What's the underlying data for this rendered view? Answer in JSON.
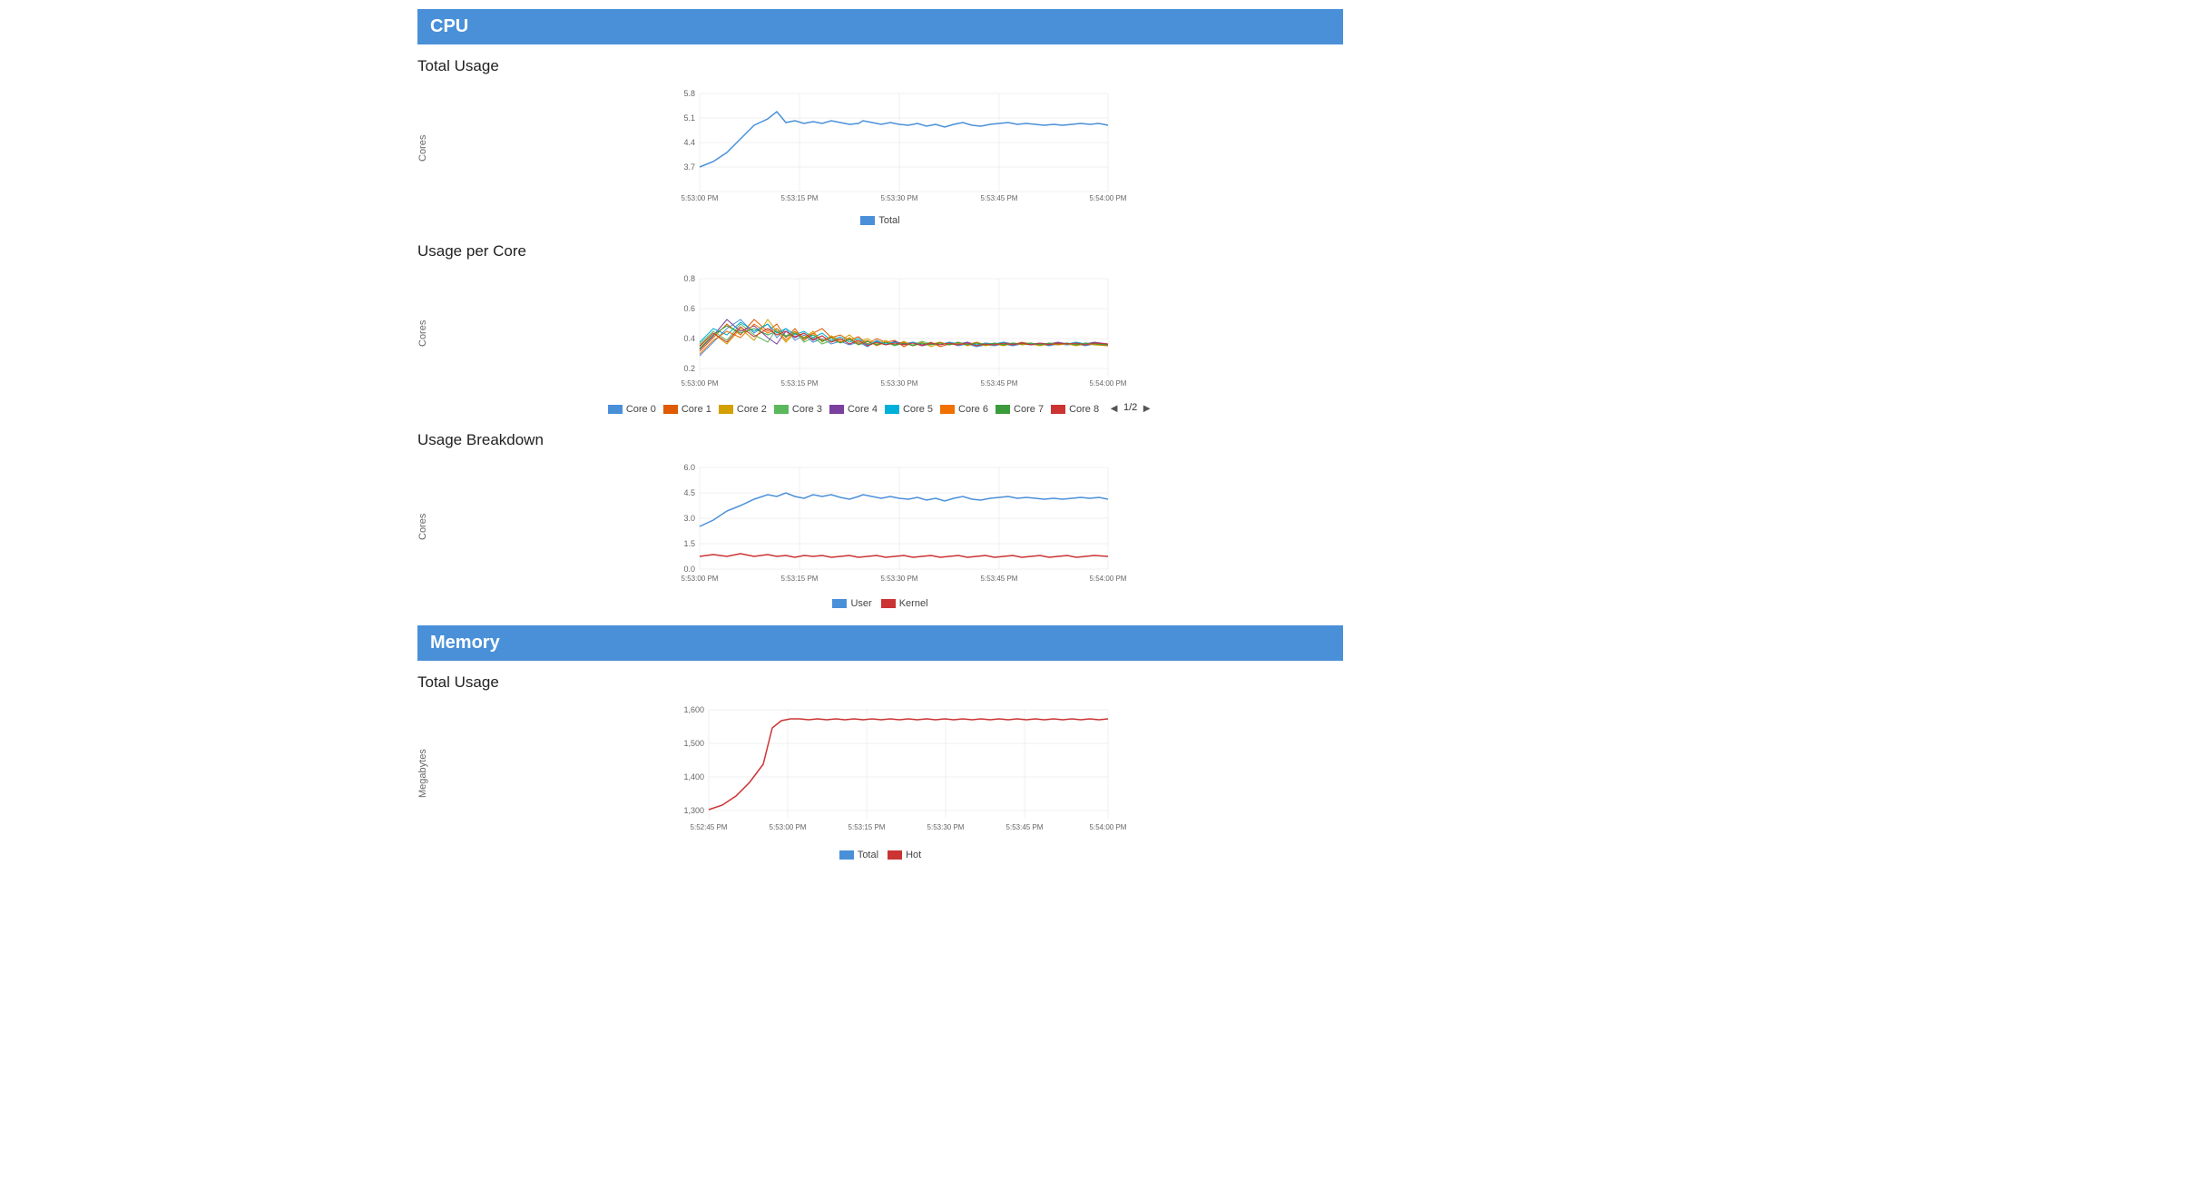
{
  "cpu_section": {
    "title": "CPU",
    "total_usage_title": "Total Usage",
    "per_core_title": "Usage per Core",
    "breakdown_title": "Usage Breakdown"
  },
  "memory_section": {
    "title": "Memory",
    "total_usage_title": "Total Usage"
  },
  "total_usage_chart": {
    "y_label": "Cores",
    "y_ticks": [
      "5.8",
      "5.1",
      "4.4",
      "3.7"
    ],
    "x_ticks": [
      "5:53:00 PM",
      "5:53:15 PM",
      "5:53:30 PM",
      "5:53:45 PM",
      "5:54:00 PM"
    ],
    "legend": [
      {
        "label": "Total",
        "color": "#4a90d9"
      }
    ]
  },
  "per_core_chart": {
    "y_label": "Cores",
    "y_ticks": [
      "0.8",
      "0.6",
      "0.4",
      "0.2"
    ],
    "x_ticks": [
      "5:53:00 PM",
      "5:53:15 PM",
      "5:53:30 PM",
      "5:53:45 PM",
      "5:54:00 PM"
    ],
    "legend": [
      {
        "label": "Core 0",
        "color": "#4a90d9"
      },
      {
        "label": "Core 1",
        "color": "#e05a00"
      },
      {
        "label": "Core 2",
        "color": "#f0c000"
      },
      {
        "label": "Core 3",
        "color": "#5cb85c"
      },
      {
        "label": "Core 4",
        "color": "#7b3f9e"
      },
      {
        "label": "Core 5",
        "color": "#00b0d8"
      },
      {
        "label": "Core 6",
        "color": "#f07000"
      },
      {
        "label": "Core 7",
        "color": "#3c9c3c"
      },
      {
        "label": "Core 8",
        "color": "#cc3333"
      }
    ],
    "page_label": "1/2"
  },
  "breakdown_chart": {
    "y_label": "Cores",
    "y_ticks": [
      "6.0",
      "4.5",
      "3.0",
      "1.5",
      "0.0"
    ],
    "x_ticks": [
      "5:53:00 PM",
      "5:53:15 PM",
      "5:53:30 PM",
      "5:53:45 PM",
      "5:54:00 PM"
    ],
    "legend": [
      {
        "label": "User",
        "color": "#4a90d9"
      },
      {
        "label": "Kernel",
        "color": "#cc3333"
      }
    ]
  },
  "memory_total_chart": {
    "y_label": "Megabytes",
    "y_ticks": [
      "1,600",
      "1,500",
      "1,400",
      "1,300"
    ],
    "x_ticks": [
      "5:52:45 PM",
      "5:53:00 PM",
      "5:53:15 PM",
      "5:53:30 PM",
      "5:53:45 PM",
      "5:54:00 PM"
    ],
    "legend": [
      {
        "label": "Total",
        "color": "#4a90d9"
      },
      {
        "label": "Hot",
        "color": "#cc3333"
      }
    ]
  }
}
